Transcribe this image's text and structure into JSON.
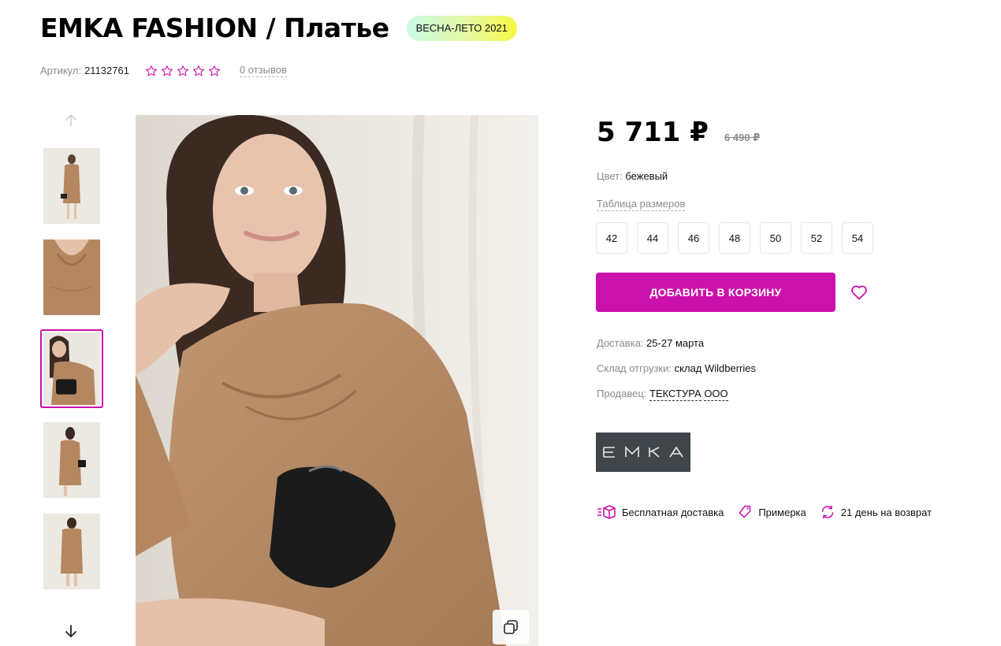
{
  "product": {
    "title": "EMKA FASHION / Платье",
    "season_badge": "ВЕСНА-ЛЕТО 2021",
    "article_label": "Артикул:",
    "article_value": "21132761",
    "rating_stars": 0,
    "reviews_link": "0 отзывов"
  },
  "gallery": {
    "thumbnails": [
      "thumb-1",
      "thumb-2",
      "thumb-3",
      "thumb-4",
      "thumb-5"
    ],
    "active_index": 2
  },
  "price": {
    "current": "5 711 ₽",
    "old": "6 490 ₽"
  },
  "color": {
    "label": "Цвет:",
    "value": "бежевый"
  },
  "size_table_link": "Таблица размеров",
  "sizes": [
    "42",
    "44",
    "46",
    "48",
    "50",
    "52",
    "54"
  ],
  "actions": {
    "add_to_cart": "ДОБАВИТЬ В КОРЗИНУ"
  },
  "delivery": {
    "label": "Доставка:",
    "value": "25-27 марта"
  },
  "warehouse": {
    "label": "Склад отгрузки:",
    "value": "склад Wildberries"
  },
  "seller": {
    "label": "Продавец:",
    "value_1": "ТЕКСТУРА",
    "value_2": "ООО"
  },
  "brand": {
    "logo_text": "EMKA"
  },
  "features": [
    "Бесплатная доставка",
    "Примерка",
    "21 день на возврат"
  ],
  "colors": {
    "accent": "#cb11ab",
    "dress": "#b48761",
    "background": "#e9e5df"
  }
}
